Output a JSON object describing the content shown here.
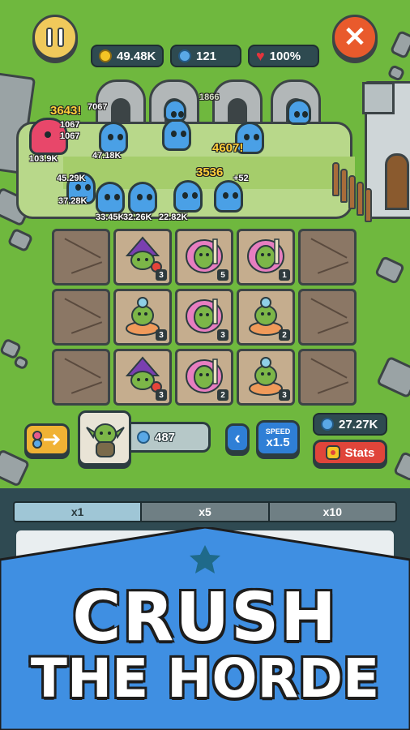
{
  "hud": {
    "coins": "49.48K",
    "gems": "121",
    "health": "100%",
    "cost": "487",
    "speed_label": "SPEED",
    "speed_value": "x1.5",
    "gem_total": "27.27K",
    "stats_label": "Stats"
  },
  "damage_numbers": [
    "3643!",
    "4607!",
    "3536",
    "1067",
    "1067",
    "103.9K",
    "47.18K",
    "45.29K",
    "37.28K",
    "33.45K",
    "32.26K",
    "22.82K",
    "+52",
    "1866",
    "7067"
  ],
  "grid": {
    "rows": [
      [
        {
          "unit": null
        },
        {
          "unit": "wizard-goblin",
          "level": "3"
        },
        {
          "unit": "pink-goblin",
          "level": "5"
        },
        {
          "unit": "pink-goblin",
          "level": "1"
        },
        {
          "unit": null
        }
      ],
      [
        {
          "unit": null
        },
        {
          "unit": "potion-goblin",
          "level": "3"
        },
        {
          "unit": "pink-goblin",
          "level": "3"
        },
        {
          "unit": "potion-goblin",
          "level": "2"
        },
        {
          "unit": null
        }
      ],
      [
        {
          "unit": null
        },
        {
          "unit": "wizard-goblin",
          "level": "3"
        },
        {
          "unit": "pink-goblin",
          "level": "2"
        },
        {
          "unit": "potion-goblin",
          "level": "3"
        },
        {
          "unit": null
        }
      ]
    ]
  },
  "tabs": [
    {
      "label": "x1",
      "active": true
    },
    {
      "label": "x5",
      "active": false
    },
    {
      "label": "x10",
      "active": false
    }
  ],
  "banner": {
    "line1": "CRUSH",
    "line2": "THE HORDE"
  },
  "colors": {
    "grass": "#6fb83e",
    "banner_blue": "#3f8fe2",
    "coin": "#f4c425",
    "gem": "#5aa8e6",
    "danger": "#e0453a"
  }
}
